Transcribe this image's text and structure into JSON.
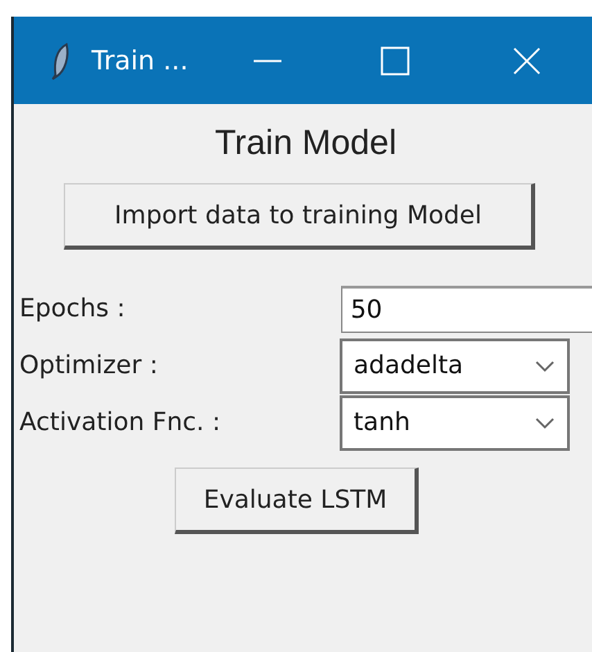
{
  "window": {
    "title": "Train ..."
  },
  "heading": "Train Model",
  "import_button": "Import data to training Model",
  "fields": [
    {
      "kind": "entry",
      "label": "Epochs :",
      "value": "50"
    },
    {
      "kind": "combo",
      "label": "Optimizer :",
      "value": "adadelta"
    },
    {
      "kind": "combo",
      "label": "Activation Fnc. :",
      "value": "tanh"
    }
  ],
  "evaluate_button": "Evaluate LSTM"
}
